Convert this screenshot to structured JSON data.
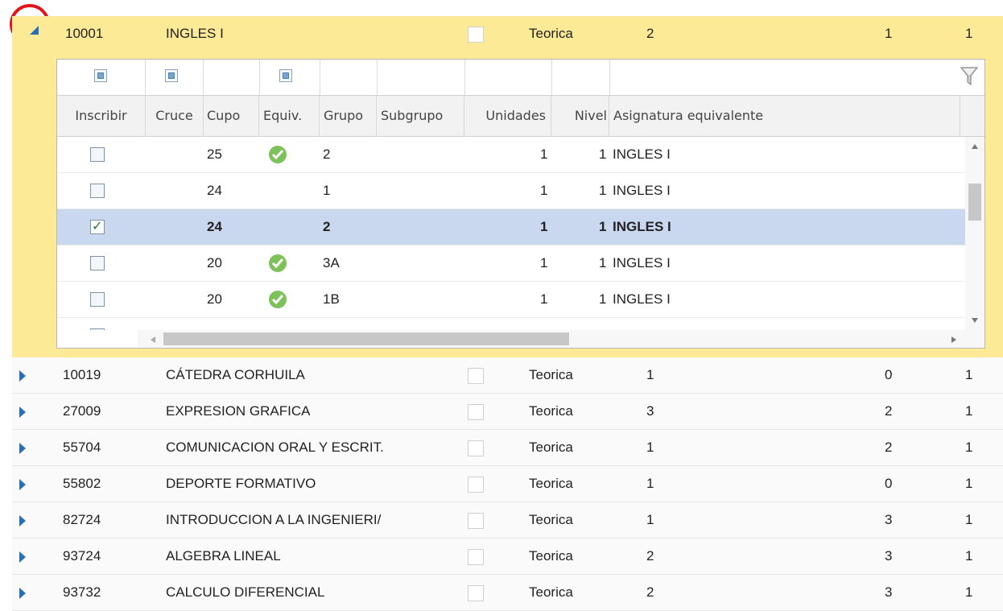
{
  "courses": [
    {
      "code": "10001",
      "name": "INGLES I",
      "type": "Teorica",
      "c1": "2",
      "c2": "1",
      "c3": "1"
    },
    {
      "code": "10019",
      "name": "CÁTEDRA CORHUILA",
      "type": "Teorica",
      "c1": "1",
      "c2": "0",
      "c3": "1"
    },
    {
      "code": "27009",
      "name": "EXPRESION GRAFICA",
      "type": "Teorica",
      "c1": "3",
      "c2": "2",
      "c3": "1"
    },
    {
      "code": "55704",
      "name": "COMUNICACION ORAL Y ESCRIT.",
      "type": "Teorica",
      "c1": "1",
      "c2": "2",
      "c3": "1"
    },
    {
      "code": "55802",
      "name": "DEPORTE FORMATIVO",
      "type": "Teorica",
      "c1": "1",
      "c2": "0",
      "c3": "1"
    },
    {
      "code": "82724",
      "name": "INTRODUCCION A LA INGENIERI/",
      "type": "Teorica",
      "c1": "1",
      "c2": "3",
      "c3": "1"
    },
    {
      "code": "93724",
      "name": "ALGEBRA LINEAL",
      "type": "Teorica",
      "c1": "2",
      "c2": "3",
      "c3": "1"
    },
    {
      "code": "93732",
      "name": "CALCULO DIFERENCIAL",
      "type": "Teorica",
      "c1": "2",
      "c2": "3",
      "c3": "1"
    }
  ],
  "subgrid": {
    "headers": {
      "inscribir": "Inscribir",
      "cruce": "Cruce",
      "cupo": "Cupo",
      "equiv": "Equiv.",
      "grupo": "Grupo",
      "subgrupo": "Subgrupo",
      "unidades": "Unidades",
      "nivel": "Nivel",
      "asignatura": "Asignatura equivalente"
    },
    "rows": [
      {
        "checked": false,
        "cupo": "25",
        "equiv": true,
        "grupo": "2",
        "unidades": "1",
        "nivel": "1",
        "asignatura": "INGLES I",
        "selected": false
      },
      {
        "checked": false,
        "cupo": "24",
        "equiv": false,
        "grupo": "1",
        "unidades": "1",
        "nivel": "1",
        "asignatura": "INGLES I",
        "selected": false
      },
      {
        "checked": true,
        "cupo": "24",
        "equiv": false,
        "grupo": "2",
        "unidades": "1",
        "nivel": "1",
        "asignatura": "INGLES I",
        "selected": true
      },
      {
        "checked": false,
        "cupo": "20",
        "equiv": true,
        "grupo": "3A",
        "unidades": "1",
        "nivel": "1",
        "asignatura": "INGLES I",
        "selected": false
      },
      {
        "checked": false,
        "cupo": "20",
        "equiv": true,
        "grupo": "1B",
        "unidades": "1",
        "nivel": "1",
        "asignatura": "INGLES I",
        "selected": false
      }
    ]
  },
  "colors": {
    "expanded_row": "#fdea97",
    "selected_row": "#c9d7ef",
    "accent": "#2a6fb6",
    "highlight_circle": "#e2151b"
  }
}
